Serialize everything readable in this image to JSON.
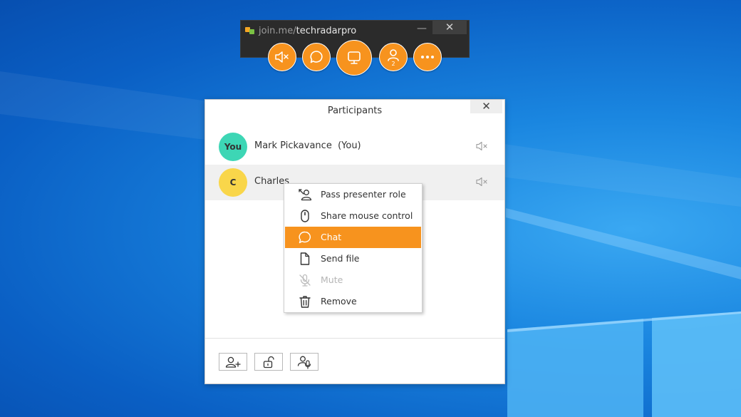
{
  "toolbar": {
    "url_prefix": "join.me/",
    "url_name": "techradarpro",
    "minimize_glyph": "—",
    "close_glyph": "✕",
    "participant_count": "2",
    "buttons": [
      "speaker-muted-icon",
      "chat-bubble-icon",
      "screen-share-icon",
      "participants-icon",
      "more-icon"
    ]
  },
  "panel": {
    "title": "Participants",
    "close_glyph": "✕",
    "participants": [
      {
        "avatar_text": "You",
        "avatar_color": "#3dd6b5",
        "name": "Mark Pickavance  (You)"
      },
      {
        "avatar_text": "C",
        "avatar_color": "#f9d64a",
        "name": "Charles"
      }
    ],
    "footer_buttons": [
      "invite-participant-icon",
      "lock-open-icon",
      "presenter-mic-icon"
    ]
  },
  "context_menu": {
    "items": [
      {
        "label": "Pass presenter role",
        "icon": "pass-presenter-icon",
        "state": "normal"
      },
      {
        "label": "Share mouse control",
        "icon": "mouse-icon",
        "state": "normal"
      },
      {
        "label": "Chat",
        "icon": "chat-bubble-icon",
        "state": "highlighted"
      },
      {
        "label": "Send file",
        "icon": "file-icon",
        "state": "normal"
      },
      {
        "label": "Mute",
        "icon": "mic-muted-icon",
        "state": "disabled"
      },
      {
        "label": "Remove",
        "icon": "trash-icon",
        "state": "normal"
      }
    ]
  },
  "colors": {
    "accent": "#f7931e",
    "toolbar_bg": "#2b2b2b",
    "desktop_blue": "#1a86e0"
  }
}
